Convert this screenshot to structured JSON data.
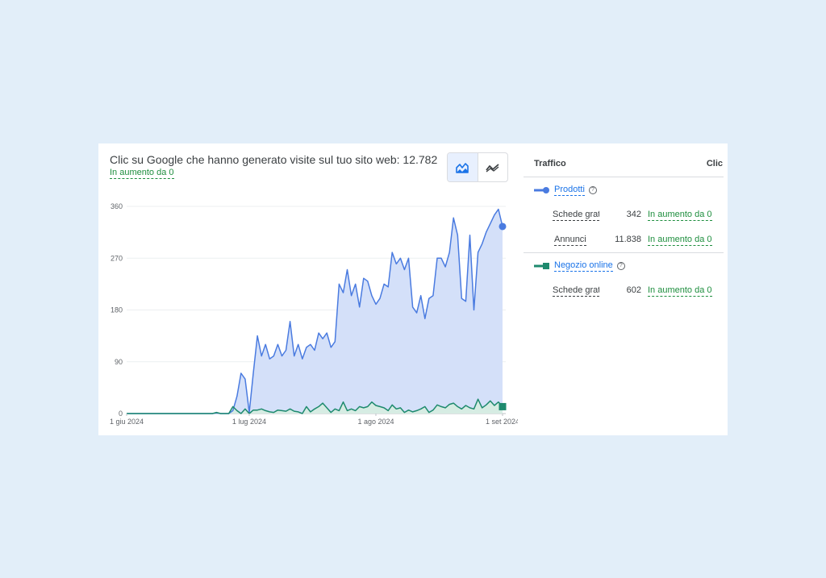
{
  "header": {
    "title": "Clic su Google che hanno generato visite sul tuo sito web: 12.782",
    "trend": "In aumento da 0"
  },
  "toggle": {
    "icons": [
      "area-chart-icon",
      "trend-chart-icon"
    ],
    "active": 0
  },
  "table": {
    "col_traffic": "Traffico",
    "col_clicks": "Clic",
    "groups": [
      {
        "name": "Prodotti",
        "color": "#4a7be0",
        "rows": [
          {
            "label": "Schede gratuite",
            "display_label": "Schede grat…",
            "value": "342",
            "change": "In aumento da 0"
          },
          {
            "label": "Annunci",
            "display_label": "Annunci",
            "value": "11.838",
            "change": "In aumento da 0"
          }
        ]
      },
      {
        "name": "Negozio online",
        "color": "#1e8a6e",
        "rows": [
          {
            "label": "Schede gratuite",
            "display_label": "Schede grat…",
            "value": "602",
            "change": "In aumento da 0"
          }
        ]
      }
    ]
  },
  "chart_data": {
    "type": "area",
    "x_start": "2024-06-01",
    "x_ticks": [
      "1 giu 2024",
      "1 lug 2024",
      "1 ago 2024",
      "1 set 2024"
    ],
    "y_ticks": [
      0,
      90,
      180,
      270,
      360
    ],
    "ylim": [
      0,
      360
    ],
    "grid": true,
    "legend": "right",
    "series": [
      {
        "name": "Prodotti",
        "color": "#4a7be0",
        "fill": "#d4e0f9",
        "values": [
          0,
          0,
          0,
          0,
          0,
          0,
          0,
          0,
          0,
          0,
          0,
          0,
          0,
          0,
          0,
          0,
          0,
          0,
          0,
          0,
          0,
          0,
          1,
          0,
          0,
          0,
          5,
          30,
          70,
          60,
          2,
          70,
          135,
          100,
          120,
          95,
          100,
          120,
          100,
          110,
          160,
          100,
          120,
          95,
          115,
          120,
          110,
          140,
          130,
          140,
          115,
          125,
          225,
          210,
          250,
          205,
          225,
          185,
          235,
          230,
          205,
          190,
          200,
          225,
          220,
          280,
          260,
          270,
          250,
          270,
          185,
          175,
          205,
          165,
          200,
          205,
          270,
          270,
          255,
          280,
          340,
          310,
          200,
          195,
          310,
          180,
          280,
          295,
          315,
          330,
          345,
          355,
          325
        ],
        "end_marker": "circle"
      },
      {
        "name": "Negozio online",
        "color": "#1e8a6e",
        "fill": "#d6ece3",
        "values": [
          0,
          0,
          0,
          0,
          0,
          0,
          0,
          0,
          0,
          0,
          0,
          0,
          0,
          0,
          0,
          0,
          0,
          0,
          0,
          0,
          0,
          0,
          2,
          0,
          0,
          0,
          12,
          5,
          0,
          8,
          0,
          6,
          6,
          8,
          5,
          3,
          2,
          6,
          5,
          4,
          8,
          4,
          3,
          0,
          12,
          3,
          8,
          12,
          18,
          10,
          2,
          8,
          5,
          20,
          5,
          8,
          5,
          12,
          10,
          12,
          20,
          14,
          12,
          10,
          5,
          15,
          8,
          10,
          2,
          6,
          3,
          5,
          8,
          12,
          2,
          6,
          15,
          12,
          10,
          16,
          18,
          12,
          8,
          14,
          10,
          8,
          25,
          10,
          15,
          22,
          14,
          20,
          12
        ]
      }
    ]
  }
}
